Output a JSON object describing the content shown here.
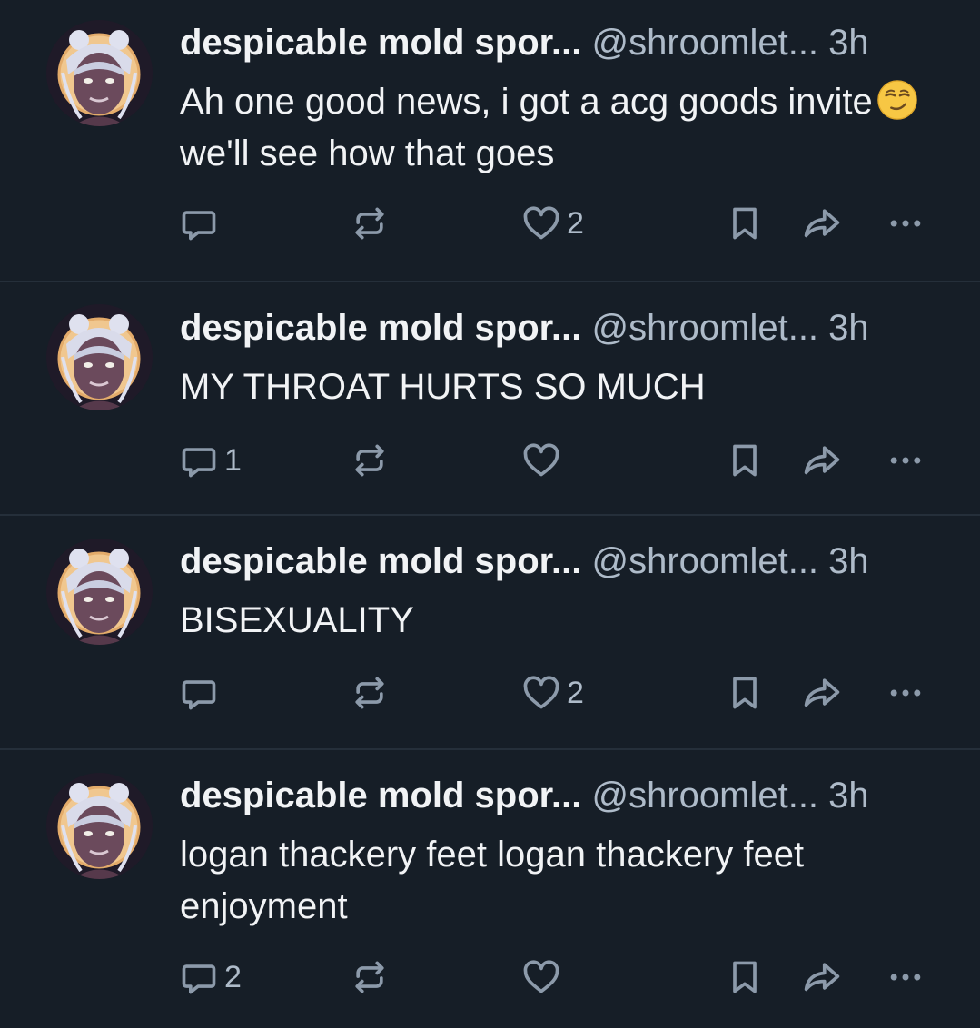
{
  "colors": {
    "background": "#161e27",
    "divider": "#252f3a",
    "text_primary": "#f1f3f5",
    "text_secondary": "#aebbc9",
    "icon": "#8c9aaa"
  },
  "icons": {
    "reply": "speech-bubble-icon",
    "repost": "repost-arrows-icon",
    "like": "heart-icon",
    "bookmark": "bookmark-icon",
    "share": "share-arrow-icon",
    "more": "ellipsis-icon"
  },
  "posts": [
    {
      "author_name": "despicable mold spor...",
      "author_handle": "@shroomlet...",
      "timestamp": "3h",
      "text_before_emoji": "Ah one good news, i got a acg goods invite",
      "emoji": "smirking-face-emoji",
      "text_after_emoji": "we'll see how that goes",
      "reply_count": "",
      "like_count": "2"
    },
    {
      "author_name": "despicable mold spor...",
      "author_handle": "@shroomlet...",
      "timestamp": "3h",
      "text": "MY THROAT HURTS SO MUCH",
      "reply_count": "1",
      "like_count": ""
    },
    {
      "author_name": "despicable mold spor...",
      "author_handle": "@shroomlet...",
      "timestamp": "3h",
      "text": "BISEXUALITY",
      "reply_count": "",
      "like_count": "2"
    },
    {
      "author_name": "despicable mold spor...",
      "author_handle": "@shroomlet...",
      "timestamp": "3h",
      "text": "logan thackery feet logan thackery feet enjoyment",
      "reply_count": "2",
      "like_count": ""
    }
  ]
}
